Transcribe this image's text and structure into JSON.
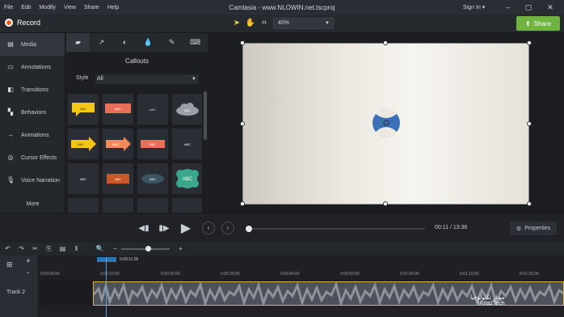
{
  "menubar": {
    "items": [
      "File",
      "Edit",
      "Modify",
      "View",
      "Share",
      "Help"
    ],
    "title": "Camtasia - www.NLOWIN.net.tscproj",
    "signin": "Sign In ▾"
  },
  "toolbar": {
    "record_label": "Record",
    "zoom_value": "45%",
    "share_label": "Share"
  },
  "nav": {
    "items": [
      {
        "label": "Media",
        "icon": "media-icon"
      },
      {
        "label": "Annotations",
        "icon": "annotations-icon"
      },
      {
        "label": "Transitions",
        "icon": "transitions-icon"
      },
      {
        "label": "Behaviors",
        "icon": "behaviors-icon"
      },
      {
        "label": "Animations",
        "icon": "animations-icon"
      },
      {
        "label": "Cursor Effects",
        "icon": "cursor-effects-icon"
      },
      {
        "label": "Voice Narration",
        "icon": "microphone-icon"
      }
    ],
    "more": "More"
  },
  "panel": {
    "title": "Callouts",
    "style_label": "Style",
    "style_value": "All",
    "callouts": [
      {
        "text": "ABC",
        "color": "#f5c518"
      },
      {
        "text": "ABC",
        "color": "#e8705a"
      },
      {
        "text": "ABC",
        "color": "#3a3d43"
      },
      {
        "text": "ABC",
        "color": "#9aa0a8"
      },
      {
        "text": "ABC",
        "color": "#f5c518"
      },
      {
        "text": "ABC",
        "color": "#f08a5d"
      },
      {
        "text": "ABC",
        "color": "#e8705a"
      },
      {
        "text": "ABC",
        "color": "#ffffff"
      },
      {
        "text": "ABC",
        "color": "#ffffff"
      },
      {
        "text": "ABC",
        "color": "#c85a2a"
      },
      {
        "text": "ABC",
        "color": "#3d5560"
      },
      {
        "text": "ABC",
        "color": "#3aa88a"
      }
    ]
  },
  "playback": {
    "time_current": "00:11",
    "time_sep": "/",
    "time_total": "13:36",
    "properties_label": "Properties"
  },
  "timeline": {
    "playhead_label": "0:00:11;05",
    "ticks": [
      "0:00:00;00",
      "0:00:10;00",
      "0:00:20;00",
      "0:00:30;00",
      "0:00:40;00",
      "0:00:50;00",
      "0:01:00;00",
      "0:01:10;00",
      "0:01:20;00"
    ],
    "track_name": "Track 2"
  },
  "watermark": {
    "line1": "موتاز تكنولوجيا",
    "line2": "MotazTech"
  }
}
